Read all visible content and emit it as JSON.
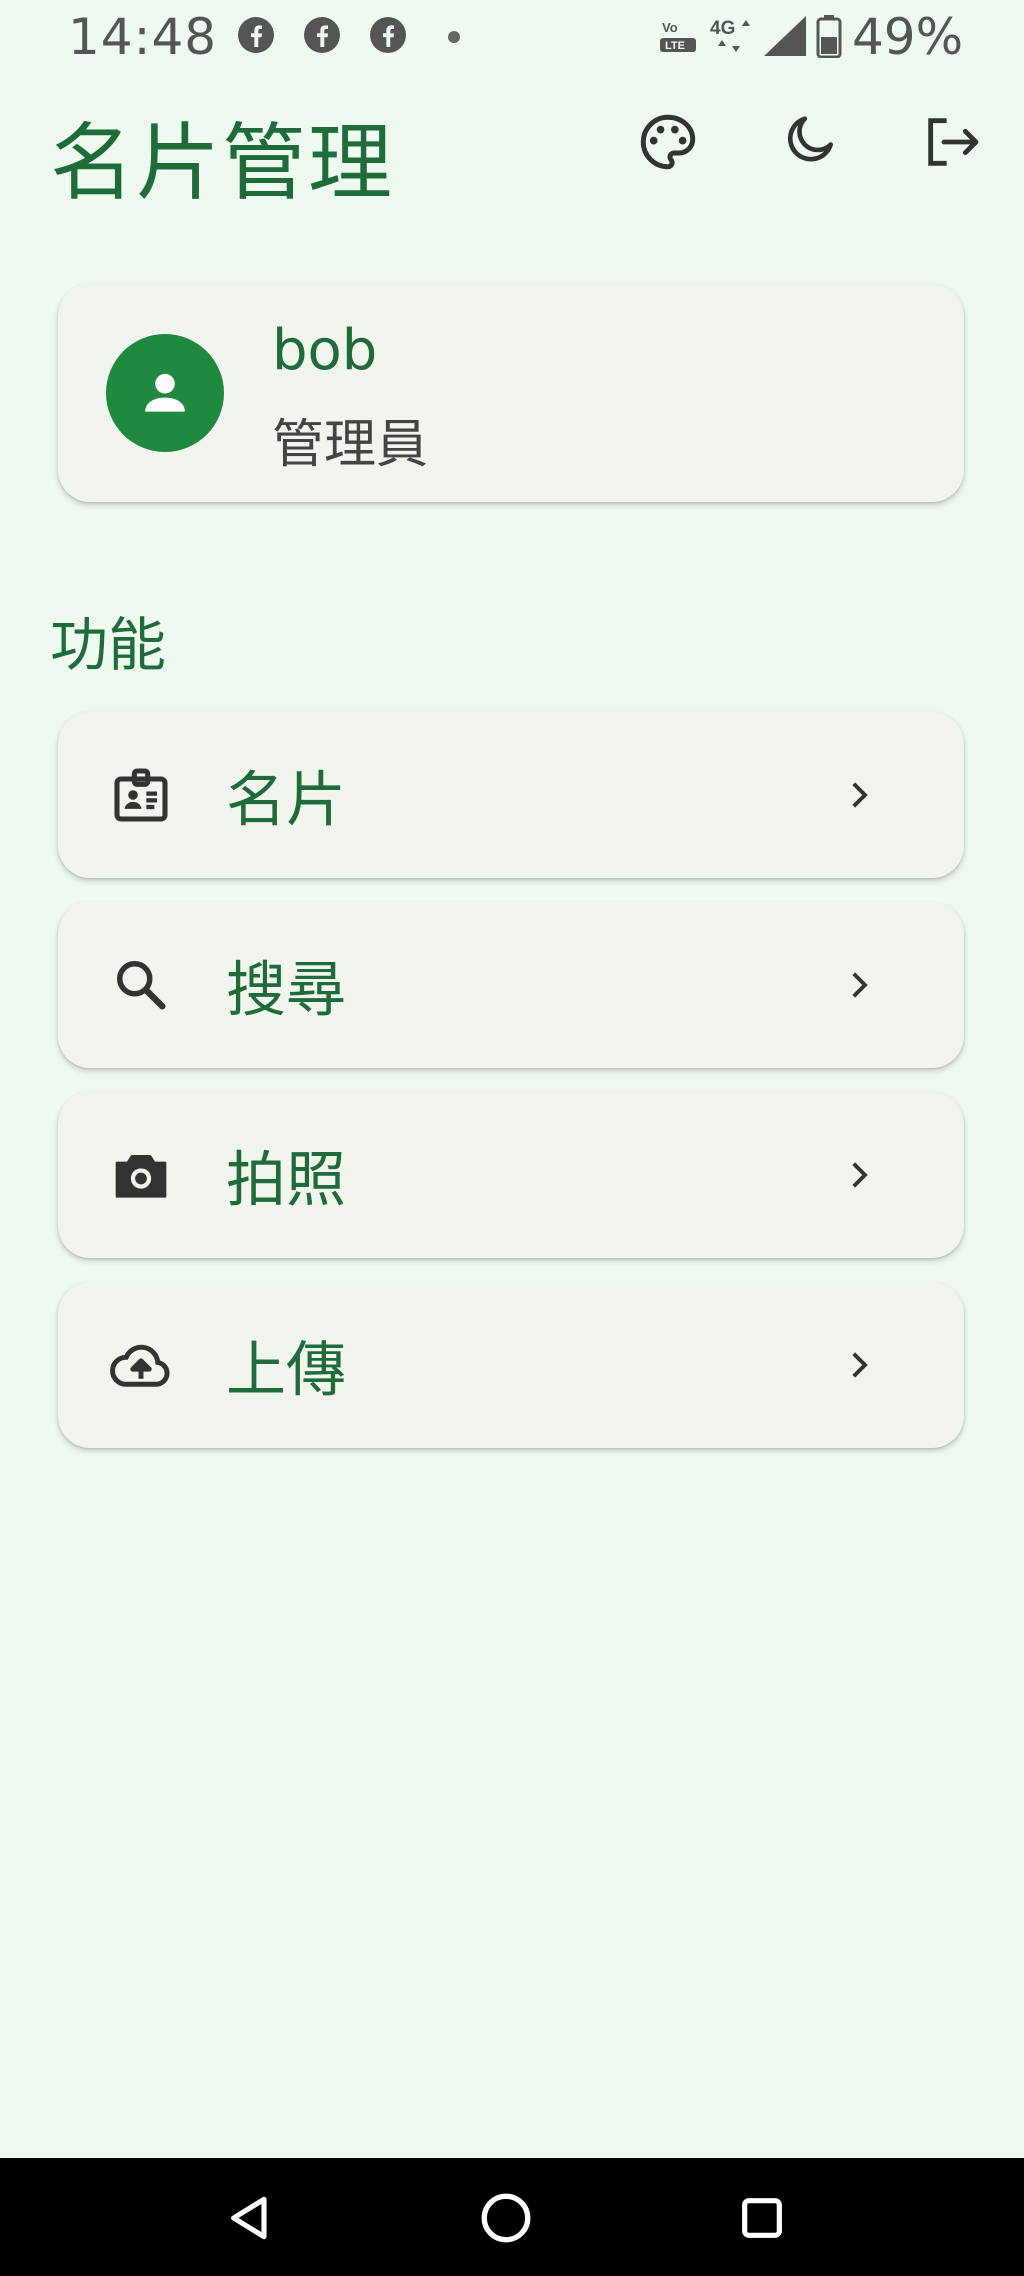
{
  "status_bar": {
    "time": "14:48",
    "battery": "49%",
    "network": "4G",
    "icons": [
      "facebook-icon",
      "facebook-icon",
      "facebook-icon",
      "notification-dot",
      "volte-icon",
      "4g-icon",
      "signal-icon",
      "battery-icon"
    ]
  },
  "app_bar": {
    "title": "名片管理",
    "actions": [
      "palette-icon",
      "dark-mode-icon",
      "logout-icon"
    ]
  },
  "user": {
    "name": "bob",
    "role": "管理員",
    "avatar_icon": "person-icon"
  },
  "section": {
    "label": "功能"
  },
  "menu": {
    "items": [
      {
        "label": "名片",
        "icon": "badge-icon"
      },
      {
        "label": "搜尋",
        "icon": "search-icon"
      },
      {
        "label": "拍照",
        "icon": "camera-icon"
      },
      {
        "label": "上傳",
        "icon": "cloud-upload-icon"
      }
    ]
  },
  "nav_bar": {
    "buttons": [
      "back-icon",
      "home-icon",
      "recents-icon"
    ]
  },
  "colors": {
    "background": "#eefaf0",
    "primary": "#1f6b3a",
    "avatar": "#1f8a3f",
    "card": "#f2f4ee"
  }
}
